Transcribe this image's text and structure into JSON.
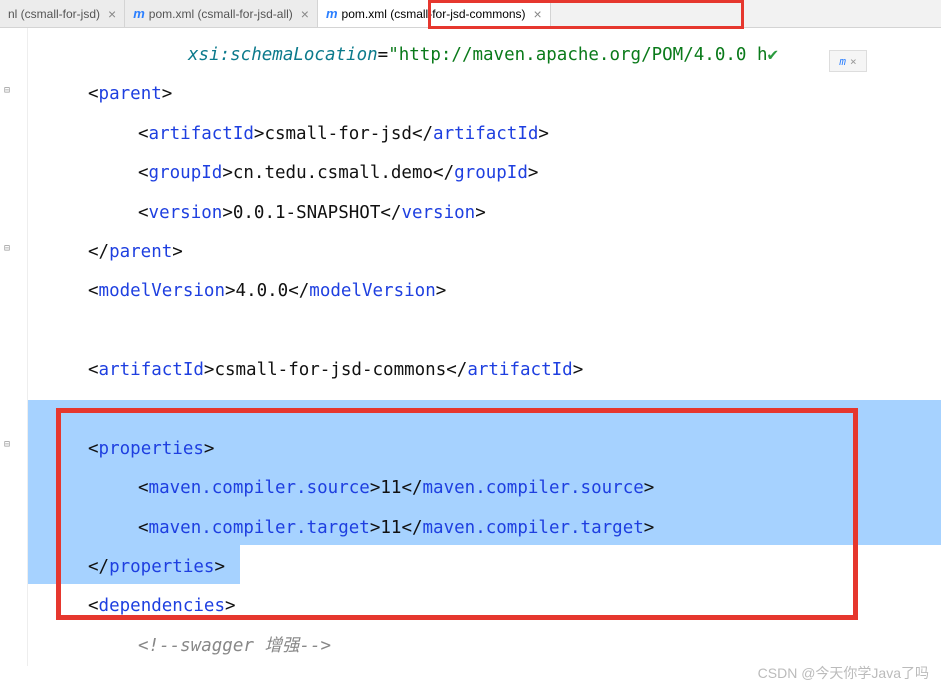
{
  "tabs": [
    {
      "label": "nl (csmall-for-jsd)",
      "icon": "",
      "active": false
    },
    {
      "label": "pom.xml (csmall-for-jsd-all)",
      "icon": "m",
      "active": false
    },
    {
      "label": "pom.xml (csmall-for-jsd-commons)",
      "icon": "m",
      "active": true
    }
  ],
  "badge": {
    "text": "m",
    "close": "×"
  },
  "xml": {
    "xsi_attr": "xsi:schemaLocation",
    "xsi_val": "\"http://maven.apache.org/POM/4.0.0 h",
    "parent_open": "parent",
    "parent_close": "parent",
    "artifactId_tag": "artifactId",
    "parent_artifact_val": "csmall-for-jsd",
    "groupId_tag": "groupId",
    "groupId_val": "cn.tedu.csmall.demo",
    "version_tag": "version",
    "version_val": "0.0.1-SNAPSHOT",
    "modelVersion_tag": "modelVersion",
    "modelVersion_val": "4.0.0",
    "artifact_val": "csmall-for-jsd-commons",
    "properties_tag": "properties",
    "compiler_source_tag": "maven.compiler.source",
    "compiler_source_val": "11",
    "compiler_target_tag": "maven.compiler.target",
    "compiler_target_val": "11",
    "dependencies_tag": "dependencies",
    "comment": "<!--swagger 增强-->"
  },
  "watermark": "CSDN @今天你学Java了吗"
}
